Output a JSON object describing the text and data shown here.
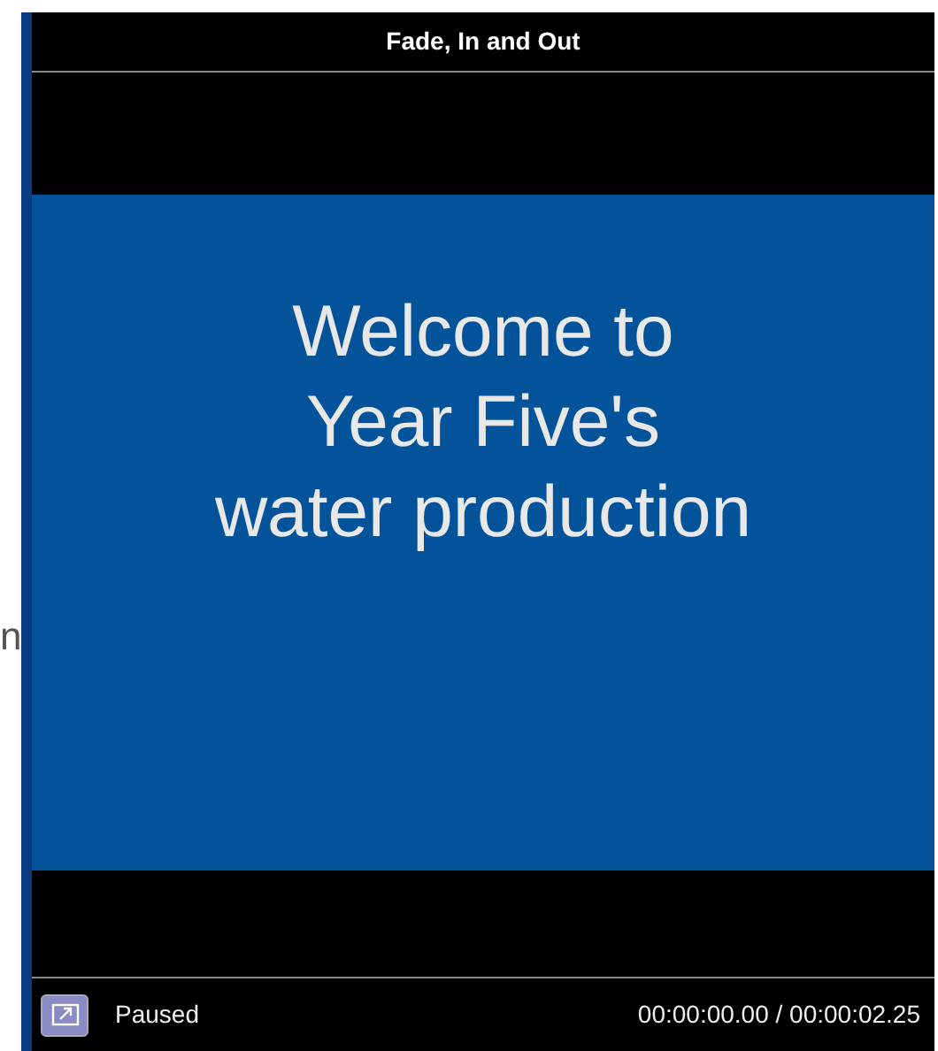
{
  "window": {
    "title": "Fade, In and Out"
  },
  "background_text": "n",
  "slide": {
    "lines": [
      "Welcome to",
      "Year Five's",
      "water production"
    ]
  },
  "status_bar": {
    "state": "Paused",
    "time": "00:00:00.00 / 00:00:02.25"
  }
}
